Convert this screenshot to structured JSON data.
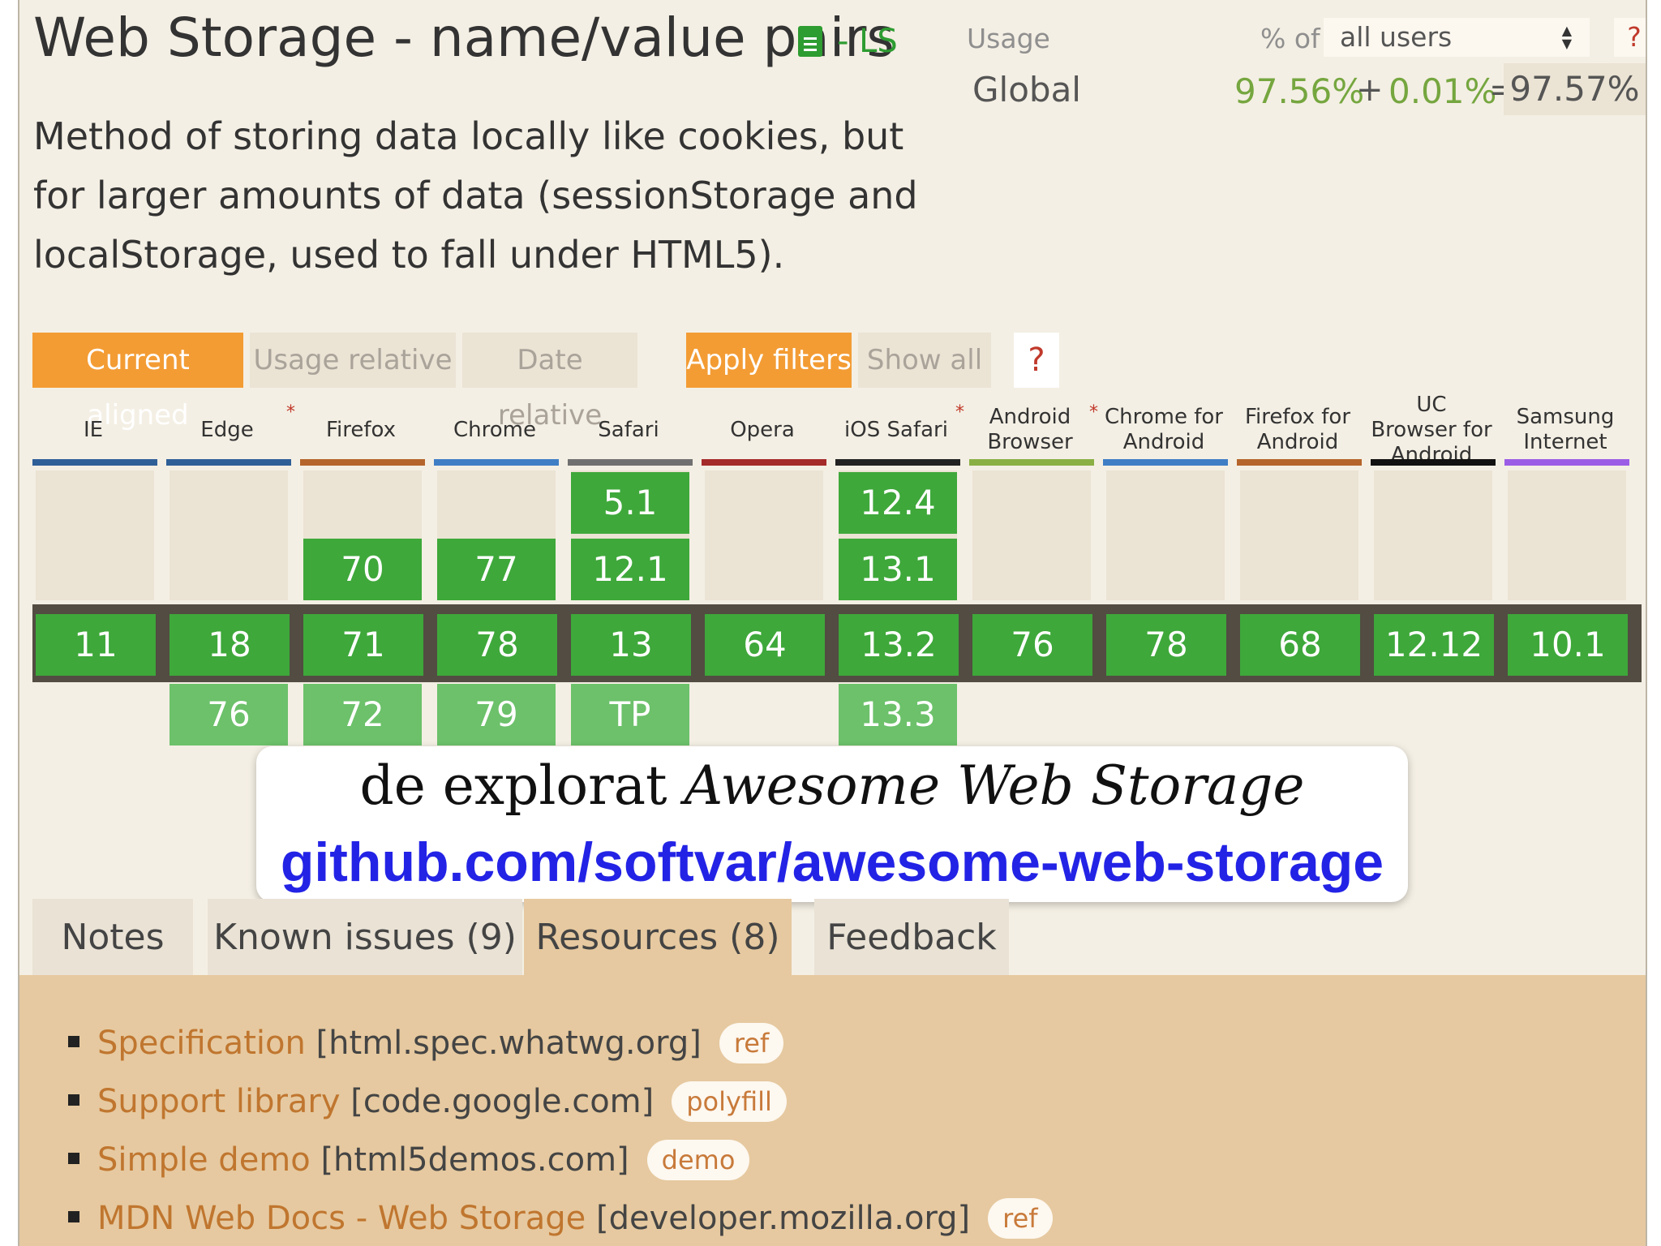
{
  "header": {
    "title": "Web Storage - name/value pairs",
    "status": "- LS",
    "description": "Method of storing data locally like cookies, but for larger amounts of data (sessionStorage and localStorage, used to fall under HTML5)."
  },
  "usage": {
    "label": "Usage",
    "percent_of_label": "% of",
    "selected_users": "all users",
    "help": "?",
    "scope": "Global",
    "full_support": "97.56%",
    "plus": "+",
    "partial_support": "0.01%",
    "equals": "=",
    "total": "97.57%"
  },
  "filters": {
    "current_aligned": "Current aligned",
    "usage_relative": "Usage relative",
    "date_relative": "Date relative",
    "apply_filters": "Apply filters",
    "show_all": "Show all",
    "help": "?"
  },
  "asterisk": "*",
  "browsers": [
    {
      "name": "IE",
      "bar": "#2f5f97",
      "past": [],
      "current": "11",
      "future": []
    },
    {
      "name": "Edge",
      "bar": "#2f5f97",
      "past": [],
      "current": "18",
      "future": [
        "76"
      ],
      "note": true
    },
    {
      "name": "Firefox",
      "bar": "#b5652b",
      "past": [
        "70"
      ],
      "current": "71",
      "future": [
        "72"
      ]
    },
    {
      "name": "Chrome",
      "bar": "#3f7ec5",
      "past": [
        "77"
      ],
      "current": "78",
      "future": [
        "79"
      ]
    },
    {
      "name": "Safari",
      "bar": "#707070",
      "past": [
        "5.1",
        "12.1"
      ],
      "current": "13",
      "future": [
        "TP"
      ]
    },
    {
      "name": "Opera",
      "bar": "#a52a2a",
      "past": [],
      "current": "64",
      "future": []
    },
    {
      "name": "iOS Safari",
      "bar": "#222222",
      "past": [
        "12.4",
        "13.1"
      ],
      "current": "13.2",
      "future": [
        "13.3"
      ],
      "note": true
    },
    {
      "name": "Android Browser",
      "bar": "#8ab045",
      "past": [],
      "current": "76",
      "future": [],
      "note": true
    },
    {
      "name": "Chrome for Android",
      "bar": "#3f7ec5",
      "past": [],
      "current": "78",
      "future": []
    },
    {
      "name": "Firefox for Android",
      "bar": "#b5652b",
      "past": [],
      "current": "68",
      "future": []
    },
    {
      "name": "UC Browser for Android",
      "bar": "#111111",
      "past": [],
      "current": "12.12",
      "future": []
    },
    {
      "name": "Samsung Internet",
      "bar": "#9b5de5",
      "past": [],
      "current": "10.1",
      "future": []
    }
  ],
  "overlay": {
    "line1_prefix": "de explorat",
    "line1_emphasis": "Awesome Web Storage",
    "line2": "github.com/softvar/awesome-web-storage"
  },
  "tabs": [
    {
      "label": "Notes",
      "active": false
    },
    {
      "label": "Known issues (9)",
      "active": false
    },
    {
      "label": "Resources (8)",
      "active": true
    },
    {
      "label": "Feedback",
      "active": false
    }
  ],
  "resources": [
    {
      "link": "Specification",
      "source": "[html.spec.whatwg.org]",
      "tag": "ref"
    },
    {
      "link": "Support library",
      "source": "[code.google.com]",
      "tag": "polyfill"
    },
    {
      "link": "Simple demo",
      "source": "[html5demos.com]",
      "tag": "demo"
    },
    {
      "link": "MDN Web Docs - Web Storage",
      "source": "[developer.mozilla.org]",
      "tag": "ref"
    }
  ],
  "colors": {
    "accent": "#f39c34",
    "supported": "#3ea83a",
    "supported_future": "#6cc16a",
    "link": "#c0762f",
    "overlay_link": "#2323e6"
  }
}
